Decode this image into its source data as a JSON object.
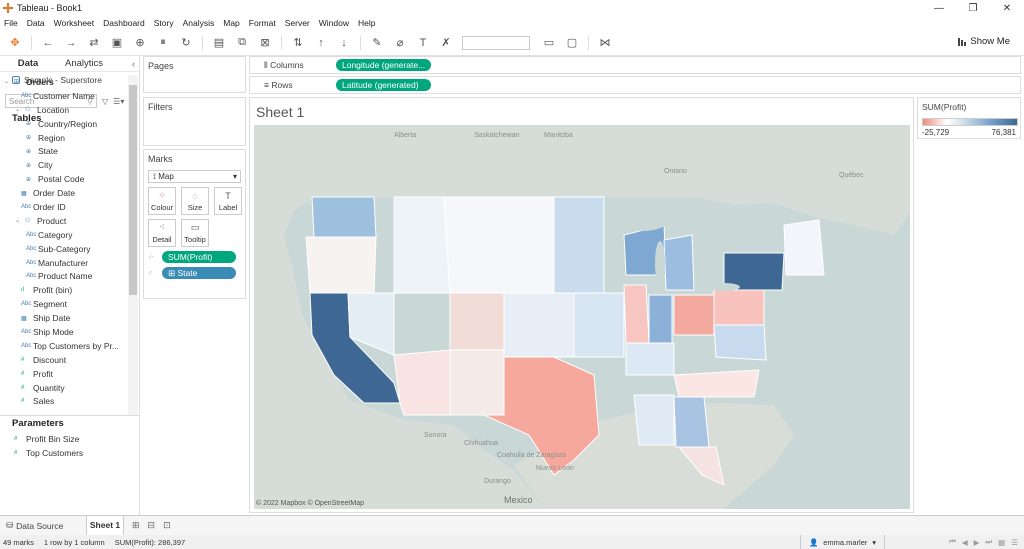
{
  "window": {
    "title": "Tableau - Book1",
    "controls": [
      "—",
      "❐",
      "✕"
    ]
  },
  "menu": [
    "File",
    "Data",
    "Worksheet",
    "Dashboard",
    "Story",
    "Analysis",
    "Map",
    "Format",
    "Server",
    "Window",
    "Help"
  ],
  "toolbar": {
    "show_me": "Show Me"
  },
  "data_pane": {
    "tab_data": "Data",
    "tab_analytics": "Analytics",
    "datasource": "Sample - Superstore",
    "search_placeholder": "Search",
    "tables_heading": "Tables",
    "fields": [
      {
        "label": "Orders",
        "type": "table",
        "indent": 0
      },
      {
        "label": "Customer Name",
        "type": "Abc",
        "indent": 1
      },
      {
        "label": "Location",
        "type": "hier",
        "indent": 1
      },
      {
        "label": "Country/Region",
        "type": "geo",
        "indent": 2
      },
      {
        "label": "Region",
        "type": "geo",
        "indent": 2
      },
      {
        "label": "State",
        "type": "geo",
        "indent": 2
      },
      {
        "label": "City",
        "type": "geo",
        "indent": 2
      },
      {
        "label": "Postal Code",
        "type": "geo",
        "indent": 2
      },
      {
        "label": "Order Date",
        "type": "date",
        "indent": 1
      },
      {
        "label": "Order ID",
        "type": "Abc",
        "indent": 1
      },
      {
        "label": "Product",
        "type": "hier",
        "indent": 1
      },
      {
        "label": "Category",
        "type": "Abc",
        "indent": 2
      },
      {
        "label": "Sub-Category",
        "type": "Abc",
        "indent": 2
      },
      {
        "label": "Manufacturer",
        "type": "Abc",
        "indent": 2
      },
      {
        "label": "Product Name",
        "type": "Abc",
        "indent": 2
      },
      {
        "label": "Profit (bin)",
        "type": "bin",
        "indent": 1
      },
      {
        "label": "Segment",
        "type": "Abc",
        "indent": 1
      },
      {
        "label": "Ship Date",
        "type": "date",
        "indent": 1
      },
      {
        "label": "Ship Mode",
        "type": "Abc",
        "indent": 1
      },
      {
        "label": "Top Customers by Pr...",
        "type": "Abc",
        "indent": 1
      },
      {
        "label": "Discount",
        "type": "#",
        "indent": 1
      },
      {
        "label": "Profit",
        "type": "#",
        "indent": 1
      },
      {
        "label": "Quantity",
        "type": "#",
        "indent": 1
      },
      {
        "label": "Sales",
        "type": "#",
        "indent": 1
      }
    ],
    "parameters_heading": "Parameters",
    "parameters": [
      "Profit Bin Size",
      "Top Customers"
    ]
  },
  "cards": {
    "pages": "Pages",
    "filters": "Filters",
    "marks": "Marks",
    "mark_type": "Map",
    "mark_buttons": [
      "Colour",
      "Size",
      "Label",
      "Detail",
      "Tooltip"
    ],
    "mark_pills": [
      "SUM(Profit)",
      "State"
    ]
  },
  "shelves": {
    "columns_label": "Columns",
    "columns_pill": "Longitude (generate...",
    "rows_label": "Rows",
    "rows_pill": "Latitude (generated)"
  },
  "sheet": {
    "title": "Sheet 1",
    "credit": "© 2022 Mapbox © OpenStreetMap"
  },
  "legend": {
    "title": "SUM(Profit)",
    "min": "-25,729",
    "max": "76,381"
  },
  "tabs": {
    "data_source": "Data Source",
    "sheet": "Sheet 1"
  },
  "status": {
    "marks": "49 marks",
    "layout": "1 row by 1 column",
    "sum": "SUM(Profit): 286,397",
    "user": "emma.marler"
  },
  "map_labels": [
    "Alberta",
    "Saskatchewan",
    "Manitoba",
    "Ontario",
    "Québec",
    "Sonora",
    "Chihuahua",
    "Coahuila de Zaragoza",
    "Nuevo León",
    "Durango",
    "Mexico"
  ],
  "colors": {
    "accent_green": "#00a67e",
    "accent_blue": "#3a8bb5",
    "neg": "#ef8b7f",
    "pos": "#3b6a96"
  }
}
